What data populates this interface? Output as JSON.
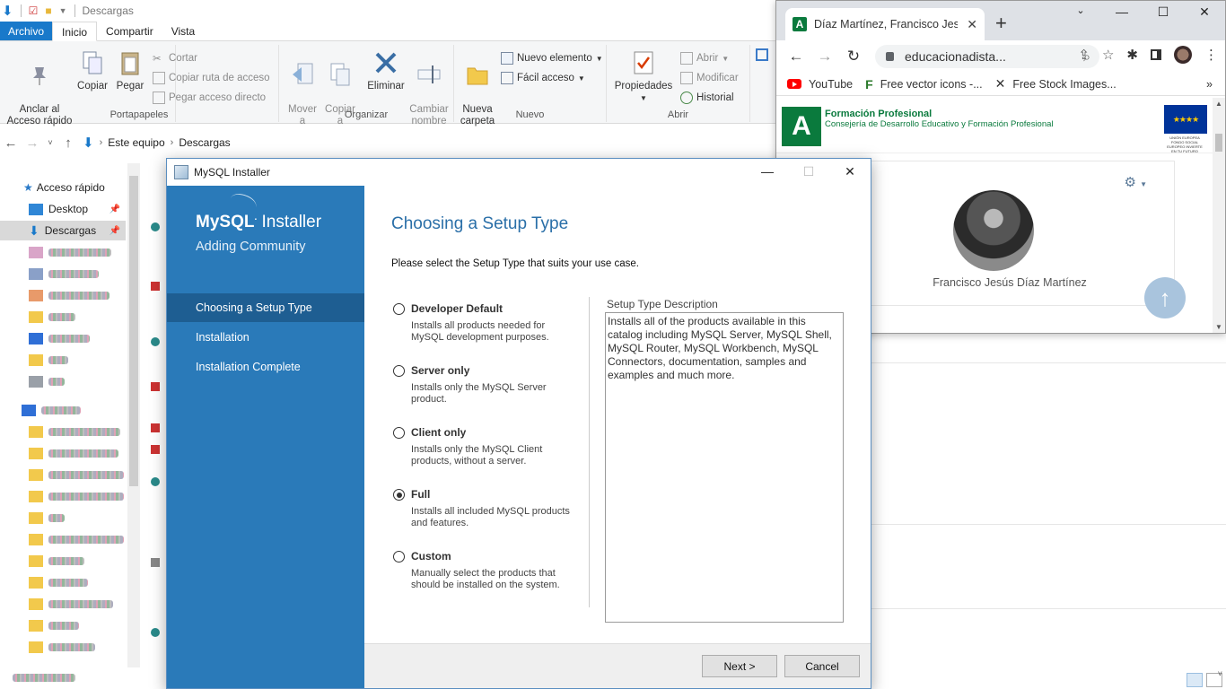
{
  "explorer": {
    "title": "Descargas",
    "ribbon_tabs": [
      "Archivo",
      "Inicio",
      "Compartir",
      "Vista"
    ],
    "portapapeles": {
      "label": "Portapapeles",
      "anclar": "Anclar al\nAcceso rápido",
      "copiar": "Copiar",
      "pegar": "Pegar",
      "cortar": "Cortar",
      "copiar_ruta": "Copiar ruta de acceso",
      "pegar_acceso": "Pegar acceso directo"
    },
    "organizar": {
      "label": "Organizar",
      "mover": "Mover\na",
      "copiar": "Copiar\na",
      "eliminar": "Eliminar",
      "cambiar": "Cambiar\nnombre"
    },
    "nuevo": {
      "label": "Nuevo",
      "nueva_carpeta": "Nueva\ncarpeta",
      "nuevo_elemento": "Nuevo elemento",
      "facil_acceso": "Fácil acceso"
    },
    "abrir": {
      "label": "Abrir",
      "propiedades": "Propiedades",
      "abrir": "Abrir",
      "modificar": "Modificar",
      "historial": "Historial"
    },
    "address": {
      "root": "Este equipo",
      "current": "Descargas"
    },
    "nav": {
      "quick_access": "Acceso rápido",
      "desktop": "Desktop",
      "downloads": "Descargas"
    }
  },
  "chrome": {
    "tab_title": "Díaz Martínez, Francisco Jesús",
    "url": "educacionadista...",
    "bookmarks": [
      "YouTube",
      "Free vector icons -...",
      "Free Stock Images..."
    ],
    "site": {
      "brand_title": "Formación Profesional",
      "brand_sub": "Consejería de Desarrollo Educativo y Formación Profesional",
      "eu_text": "UNIÓN EUROPEA FONDO SOCIAL EUROPEO INVIERTE EN TU FUTURO",
      "profile_name": "Francisco Jesús Díaz Martínez"
    }
  },
  "mysql": {
    "window_title": "MySQL Installer",
    "logo_main": "MySQL",
    "logo_installer": "Installer",
    "subtitle": "Adding Community",
    "steps": [
      "Choosing a Setup Type",
      "Installation",
      "Installation Complete"
    ],
    "heading": "Choosing a Setup Type",
    "instruction": "Please select the Setup Type that suits your use case.",
    "options": [
      {
        "label": "Developer Default",
        "desc": "Installs all products needed for MySQL development purposes.",
        "selected": false
      },
      {
        "label": "Server only",
        "desc": "Installs only the MySQL Server product.",
        "selected": false
      },
      {
        "label": "Client only",
        "desc": "Installs only the MySQL Client products, without a server.",
        "selected": false
      },
      {
        "label": "Full",
        "desc": "Installs all included MySQL products and features.",
        "selected": true
      },
      {
        "label": "Custom",
        "desc": "Manually select the products that should be installed on the system.",
        "selected": false
      }
    ],
    "description_label": "Setup Type Description",
    "description_text": "Installs all of the products available in this catalog including MySQL Server, MySQL Shell, MySQL Router, MySQL Workbench, MySQL Connectors, documentation, samples and examples and much more.",
    "next_button": "Next >",
    "cancel_button": "Cancel"
  }
}
